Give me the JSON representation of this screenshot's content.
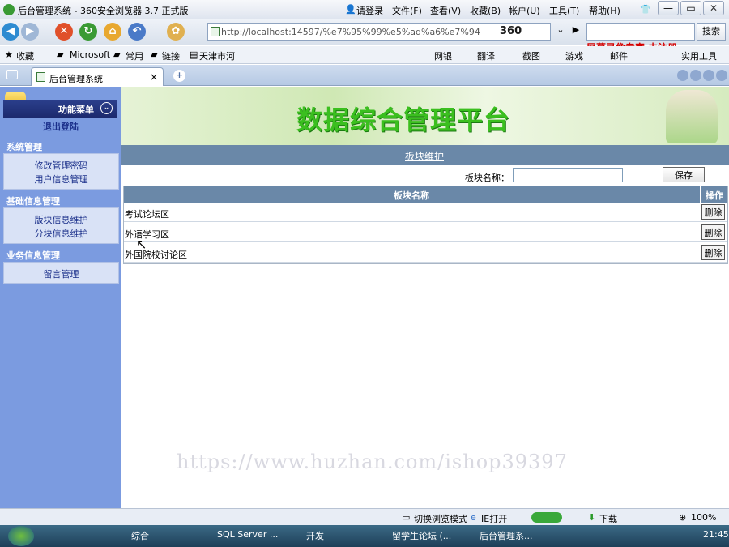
{
  "browser": {
    "title": "后台管理系统 - 360安全浏览器 3.7 正式版",
    "login": "请登录",
    "menus": [
      "文件(F)",
      "查看(V)",
      "收藏(B)",
      "帐户(U)",
      "工具(T)",
      "帮助(H)"
    ],
    "url": "http://localhost:14597/%e7%95%99%e5%ad%a6%e7%94",
    "brand": "360",
    "search_button": "搜索",
    "favorites": [
      "收藏",
      "Microsoft",
      "常用",
      "链接",
      "天津市河"
    ],
    "tools": [
      "网银",
      "翻译",
      "截图",
      "游戏",
      "邮件",
      "实用工具"
    ],
    "tab_label": "后台管理系统"
  },
  "overlay_watermark": "屏幕录像专家 未注册",
  "sidebar": {
    "menu_title": "功能菜单",
    "logout": "退出登陆",
    "sections": [
      {
        "title": "系统管理",
        "items": [
          "修改管理密码",
          "用户信息管理"
        ]
      },
      {
        "title": "基础信息管理",
        "items": [
          "版块信息维护",
          "分块信息维护"
        ]
      },
      {
        "title": "业务信息管理",
        "items": [
          "留言管理"
        ]
      }
    ]
  },
  "main": {
    "banner_title": "数据综合管理平台",
    "module_title": "板块维护",
    "form_label": "板块名称：",
    "input_value": "",
    "save_label": "保存",
    "table": {
      "col_name": "板块名称",
      "col_action": "操作",
      "rows": [
        "考试论坛区",
        "外语学习区",
        "外国院校讨论区"
      ],
      "delete_label": "删除"
    },
    "url_watermark": "https://www.huzhan.com/ishop39397"
  },
  "statusbar": {
    "mode": "切换浏览模式",
    "ie_open": "IE打开",
    "download": "下载",
    "zoom": "100%"
  },
  "taskbar": {
    "items": [
      "综合",
      "SQL Server ...",
      "开发",
      "留学生论坛 (...",
      "后台管理系..."
    ],
    "clock": "21:45"
  }
}
